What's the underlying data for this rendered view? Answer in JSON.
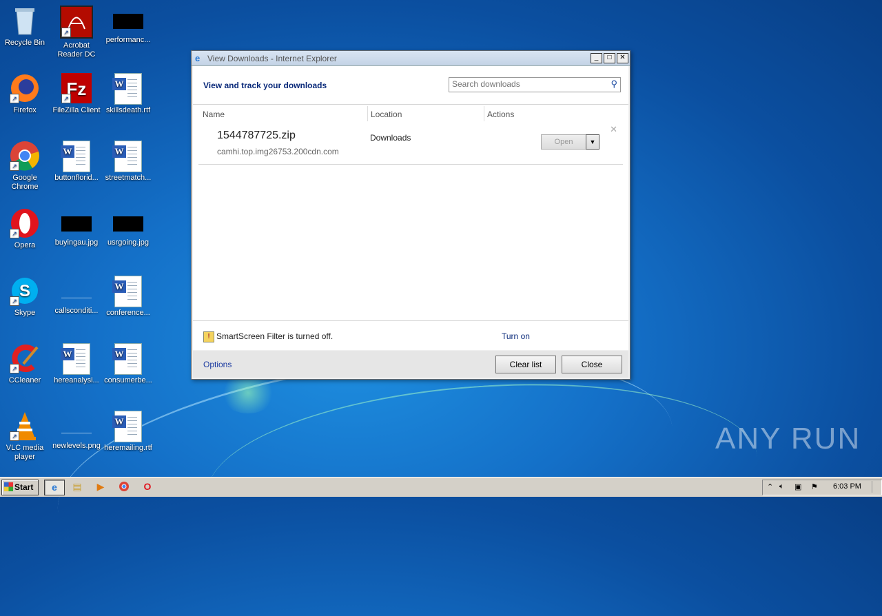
{
  "desktop": {
    "icons": [
      {
        "label": "Recycle Bin"
      },
      {
        "label": "Acrobat Reader DC"
      },
      {
        "label": "performanc..."
      },
      {
        "label": "Firefox"
      },
      {
        "label": "FileZilla Client"
      },
      {
        "label": "skillsdeath.rtf"
      },
      {
        "label": "Google Chrome"
      },
      {
        "label": "buttonflorid..."
      },
      {
        "label": "streetmatch..."
      },
      {
        "label": "Opera"
      },
      {
        "label": "buyingau.jpg"
      },
      {
        "label": "usrgoing.jpg"
      },
      {
        "label": "Skype"
      },
      {
        "label": "callsconditi..."
      },
      {
        "label": "conference..."
      },
      {
        "label": "CCleaner"
      },
      {
        "label": "hereanalysi..."
      },
      {
        "label": "consumerbe..."
      },
      {
        "label": "VLC media player"
      },
      {
        "label": "newlevels.png"
      },
      {
        "label": "heremailing.rtf"
      }
    ]
  },
  "window": {
    "title": "View Downloads - Internet Explorer",
    "heading": "View and track your downloads",
    "search_placeholder": "Search downloads",
    "columns": {
      "name": "Name",
      "location": "Location",
      "actions": "Actions"
    },
    "downloads": [
      {
        "filename": "1544787725.zip",
        "source": "camhi.top.img26753.200cdn.com",
        "location": "Downloads",
        "action": "Open"
      }
    ],
    "smartscreen_message": "SmartScreen Filter is turned off.",
    "turn_on": "Turn on",
    "options": "Options",
    "clear_list": "Clear list",
    "close": "Close"
  },
  "watermark": "ANY RUN",
  "taskbar": {
    "start_label": "Start",
    "clock": "6:03 PM"
  }
}
